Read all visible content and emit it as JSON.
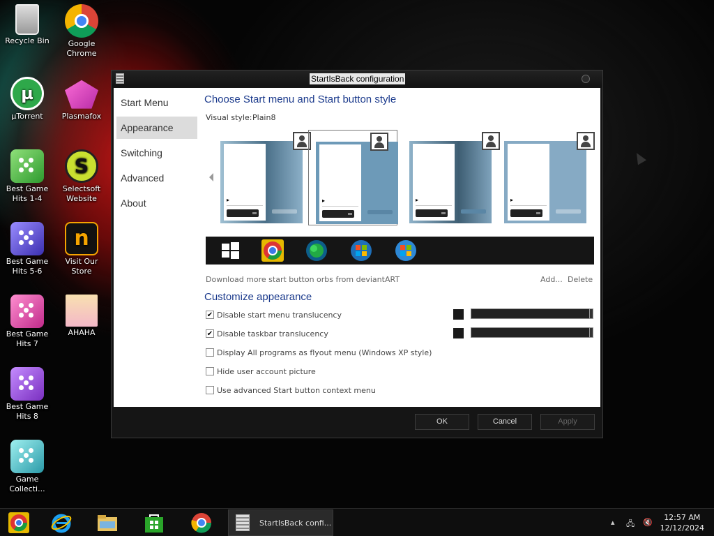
{
  "desktop": {
    "icons": [
      {
        "label": "Recycle Bin",
        "icon": "recycle-bin-icon"
      },
      {
        "label": "Google\nChrome",
        "icon": "chrome-icon"
      },
      {
        "label": "µTorrent",
        "icon": "utorrent-icon"
      },
      {
        "label": "Plasmafox",
        "icon": "plasmafox-icon"
      },
      {
        "label": "Best Game\nHits 1-4",
        "icon": "dice-green-icon"
      },
      {
        "label": "Selectsoft\nWebsite",
        "icon": "selectsoft-icon"
      },
      {
        "label": "Best Game\nHits 5-6",
        "icon": "dice-blue-icon"
      },
      {
        "label": "Visit Our\nStore",
        "icon": "store-icon"
      },
      {
        "label": "Best Game\nHits 7",
        "icon": "dice-pink-icon"
      },
      {
        "label": "AHAHA",
        "icon": "ahaha-anime-icon"
      },
      {
        "label": "Best Game\nHits 8",
        "icon": "dice-purple-icon"
      },
      {
        "label": "Game\nCollecti...",
        "icon": "dice-teal-icon"
      }
    ]
  },
  "window": {
    "title": "StartIsBack configuration",
    "nav": [
      "Start Menu",
      "Appearance",
      "Switching",
      "Advanced",
      "About"
    ],
    "active_nav": "Appearance",
    "section1_title": "Choose Start menu and Start button style",
    "visual_style_label": "Visual style:",
    "visual_style_value": "Plain8",
    "orbs_note": "Download more start button orbs from deviantART",
    "add_label": "Add...",
    "delete_label": "Delete",
    "section2_title": "Customize appearance",
    "options": [
      {
        "label": "Disable start menu translucency",
        "checked": true
      },
      {
        "label": "Disable taskbar translucency",
        "checked": true
      },
      {
        "label": "Display All programs as flyout menu (Windows XP style)",
        "checked": false
      },
      {
        "label": "Hide user account picture",
        "checked": false
      },
      {
        "label": "Use advanced Start button context menu",
        "checked": false
      }
    ],
    "buttons": {
      "ok": "OK",
      "cancel": "Cancel",
      "apply": "Apply"
    }
  },
  "taskbar": {
    "pinned": [
      "chrome-icon",
      "internet-explorer-icon",
      "file-explorer-icon",
      "store-icon",
      "chrome-icon"
    ],
    "task_label": "StartIsBack confi...",
    "time": "12:57 AM",
    "date": "12/12/2024"
  },
  "colors": {
    "heading": "#1b3a8c",
    "accent_preview": "#6d9ab8"
  }
}
